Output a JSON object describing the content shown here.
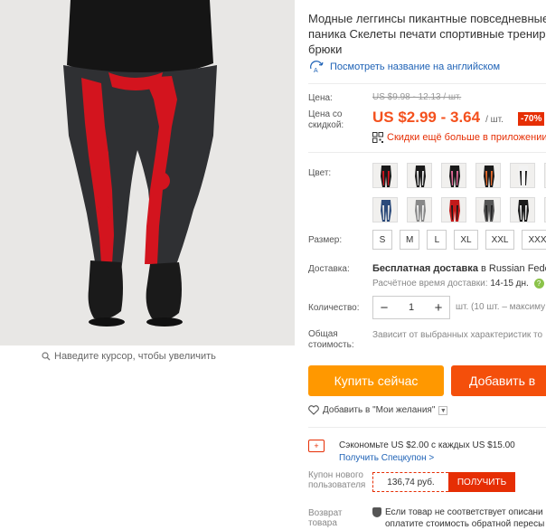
{
  "gallery": {
    "zoom_hint": "Наведите курсор, чтобы увеличить"
  },
  "product": {
    "title": "Модные леггинсы пикантные повседневные паника Скелеты печати спортивные тренир брюки",
    "translate_link": "Посмотреть название на английском"
  },
  "price": {
    "label": "Цена:",
    "old_value": "US $9.98 - 12.13 / шт.",
    "sale_label": "Цена со скидкой:",
    "sale_value": "US $2.99 - 3.64",
    "sale_unit": "/ шт.",
    "discount": "-70%",
    "app_deal": "Скидки ещё больше в приложении"
  },
  "color": {
    "label": "Цвет:",
    "swatches": [
      {
        "name": "black-red"
      },
      {
        "name": "black-white"
      },
      {
        "name": "black-pink"
      },
      {
        "name": "black-orange"
      },
      {
        "name": "white-black"
      },
      {
        "name": "black-red-2"
      },
      {
        "name": "blue-white"
      },
      {
        "name": "grey-white"
      },
      {
        "name": "red-black"
      },
      {
        "name": "grey-dark"
      },
      {
        "name": "black-white-2"
      },
      {
        "name": "beige"
      }
    ]
  },
  "size": {
    "label": "Размер:",
    "options": [
      "S",
      "M",
      "L",
      "XL",
      "XXL",
      "XXXL"
    ]
  },
  "shipping": {
    "label": "Доставка:",
    "free": "Бесплатная доставка",
    "to_prefix": "в",
    "destination": "Russian Federa",
    "time_label": "Расчётное время доставки:",
    "time_value": "14-15 дн."
  },
  "quantity": {
    "label": "Количество:",
    "value": "1",
    "note": "шт. (10 шт. – максиму"
  },
  "total": {
    "label": "Общая стоимость:",
    "note": "Зависит от выбранных характеристик то"
  },
  "actions": {
    "buy": "Купить сейчас",
    "cart": "Добавить в",
    "wishlist": "Добавить в \"Мои желания\""
  },
  "coupon": {
    "save": "Сэкономьте US $2.00 с каждых US $15.00",
    "link": "Получить Спецкупон >"
  },
  "new_user": {
    "label": "Купон нового пользователя",
    "amount": "136,74 руб.",
    "get": "ПОЛУЧИТЬ"
  },
  "returns": {
    "label": "Возврат товара",
    "line1": "Если товар не соответствует описани",
    "line2": "оплатите стоимость обратной пересы"
  },
  "colors": {
    "accent_orange": "#f4511e",
    "buy_button": "#ff9800",
    "cart_button": "#f44f0b",
    "link_blue": "#1e62b6",
    "discount_red": "#e62e04"
  }
}
